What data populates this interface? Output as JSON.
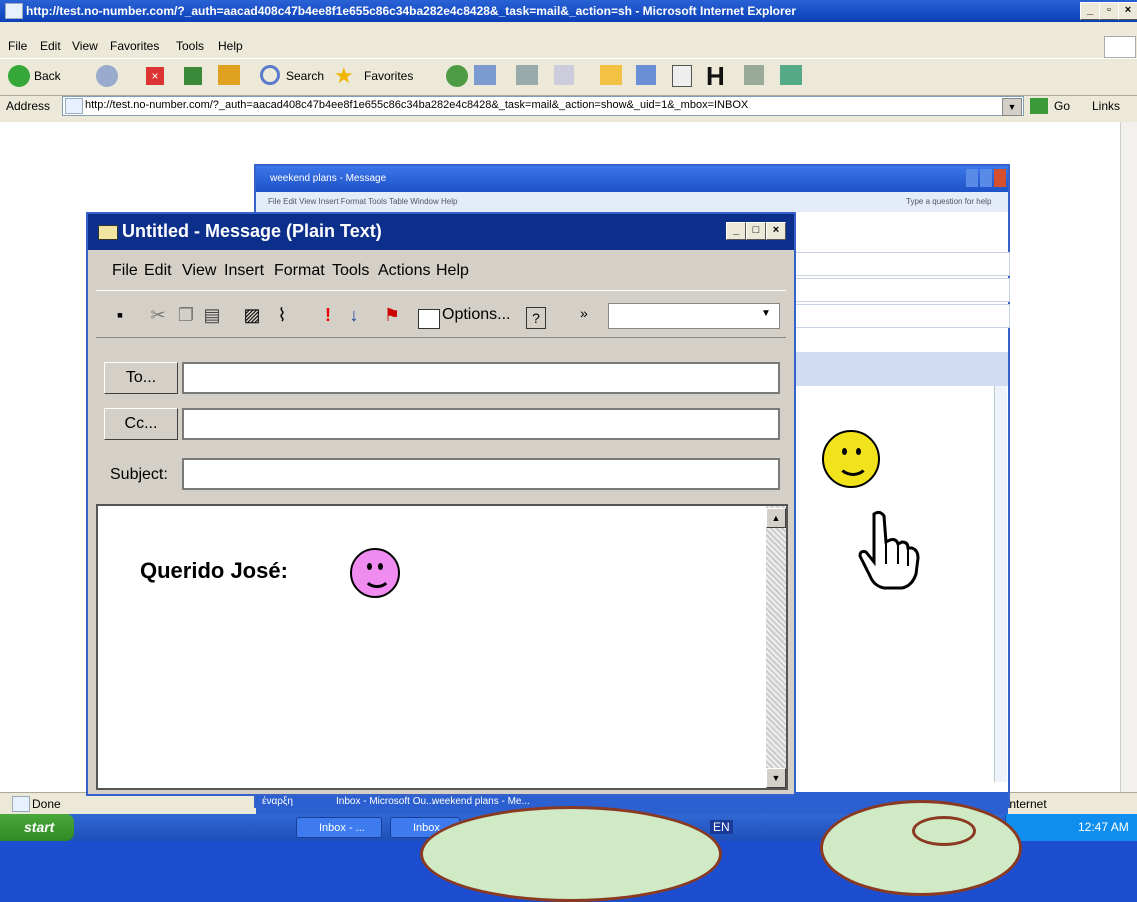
{
  "ie": {
    "title": "http://test.no-number.com/?_auth=aacad408c47b4ee8f1e655c86c34ba282e4c8428&_task=mail&_action=sh - Microsoft Internet Explorer",
    "menu": [
      "File",
      "Edit",
      "View",
      "Favorites",
      "Tools",
      "Help"
    ],
    "toolbar": {
      "back": "Back",
      "search": "Search",
      "favorites": "Favorites"
    },
    "address_label": "Address",
    "address": "http://test.no-number.com/?_auth=aacad408c47b4ee8f1e655c86c34ba282e4c8428&_task=mail&_action=show&_uid=1&_mbox=INBOX",
    "go_label": "Go",
    "links_label": "Links",
    "status_done": "Done",
    "status_zone": "Internet"
  },
  "taskbar": {
    "start_label": "start",
    "tasks": [
      "Inbox - ...",
      "Inbox"
    ],
    "lang": "EN",
    "clock": "12:47 AM"
  },
  "bg_window": {
    "title": "weekend plans - Message",
    "menu": "File Edit View Insert Format Tools Table Window Help",
    "ask": "Type a question for help",
    "task_strip": [
      "έναρξη",
      "Inbox - Microsoft Ou...",
      "weekend plans - Me..."
    ]
  },
  "compose": {
    "title": "Untitled - Message (Plain Text)",
    "menu": [
      "File",
      "Edit",
      "View",
      "Insert",
      "Format",
      "Tools",
      "Actions",
      "Help"
    ],
    "options_label": "Options...",
    "to_label": "To...",
    "cc_label": "Cc...",
    "subject_label": "Subject:",
    "to_value": "",
    "cc_value": "",
    "subject_value": "",
    "body_greeting": "Querido José:"
  },
  "colors": {
    "yellow_smiley": "#f2e21c",
    "pink_smiley": "#f08cf0",
    "title_blue": "#0c2f8c"
  }
}
